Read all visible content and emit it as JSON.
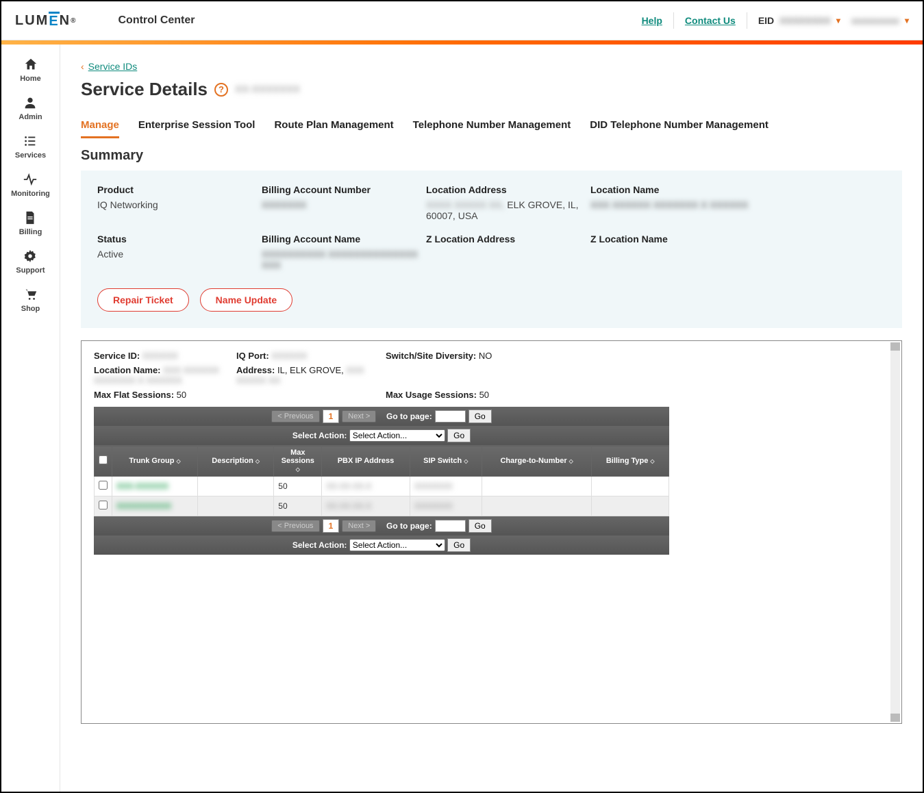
{
  "header": {
    "logo_text": "LUMEN",
    "app_title": "Control Center",
    "help": "Help",
    "contact": "Contact Us",
    "eid_label": "EID",
    "eid_value": "XXXXXXXX",
    "user_value": "xxxxxxxxx"
  },
  "sidebar": [
    {
      "name": "home",
      "label": "Home"
    },
    {
      "name": "admin",
      "label": "Admin"
    },
    {
      "name": "services",
      "label": "Services"
    },
    {
      "name": "monitoring",
      "label": "Monitoring"
    },
    {
      "name": "billing",
      "label": "Billing"
    },
    {
      "name": "support",
      "label": "Support"
    },
    {
      "name": "shop",
      "label": "Shop"
    }
  ],
  "breadcrumb": {
    "back_label": "Service IDs"
  },
  "page": {
    "title": "Service Details",
    "id_value": "XX-XXXXXXX"
  },
  "tabs": [
    {
      "label": "Manage",
      "active": true
    },
    {
      "label": "Enterprise Session Tool"
    },
    {
      "label": "Route Plan Management"
    },
    {
      "label": "Telephone Number Management"
    },
    {
      "label": "DID Telephone Number Management"
    }
  ],
  "summary": {
    "heading": "Summary",
    "product": {
      "label": "Product",
      "value": "IQ Networking"
    },
    "ban": {
      "label": "Billing Account Number",
      "value": "XXXXXXX"
    },
    "loc_addr": {
      "label": "Location Address",
      "value_prefix": "XXXX XXXXX XX,",
      "value_suffix": " ELK GROVE, IL, 60007, USA"
    },
    "loc_name": {
      "label": "Location Name",
      "value": "XXX XXXXXX XXXXXXX X XXXXXX"
    },
    "status": {
      "label": "Status",
      "value": "Active"
    },
    "ba_name": {
      "label": "Billing Account Name",
      "value": "XXXXXXXXXX XXXXXXXXXXXXXX XXX"
    },
    "z_loc_addr": {
      "label": "Z Location Address",
      "value": ""
    },
    "z_loc_name": {
      "label": "Z Location Name",
      "value": ""
    },
    "buttons": {
      "repair": "Repair Ticket",
      "name_update": "Name Update"
    }
  },
  "inner": {
    "service_id": {
      "label": "Service ID:",
      "value": "XXXXXX"
    },
    "iq_port": {
      "label": "IQ Port:",
      "value": "XXXXXX"
    },
    "switch_div": {
      "label": "Switch/Site Diversity:",
      "value": "NO"
    },
    "loc_name": {
      "label": "Location Name:",
      "value": "XXX XXXXXX XXXXXXX X XXXXXX"
    },
    "address": {
      "label": "Address:",
      "value_prefix": "IL, ELK GROVE, ",
      "value_suffix": "XXX XXXXX XX"
    },
    "max_flat": {
      "label": "Max Flat Sessions:",
      "value": "50"
    },
    "max_usage": {
      "label": "Max Usage Sessions:",
      "value": "50"
    }
  },
  "pager": {
    "prev": "< Previous",
    "next": "Next >",
    "page_num": "1",
    "goto_label": "Go to page:",
    "go": "Go",
    "select_action_label": "Select Action:",
    "select_action_value": "Select Action..."
  },
  "table": {
    "columns": [
      "",
      "Trunk Group",
      "Description",
      "Max Sessions",
      "PBX IP Address",
      "SIP Switch",
      "Charge-to-Number",
      "Billing Type"
    ],
    "rows": [
      {
        "trunk_group": "XXX-XXXXXX",
        "description": "",
        "max_sessions": "50",
        "pbx_ip": "XX.XX.XX.X",
        "sip_switch": "XXXXXXX",
        "charge_to": "",
        "billing_type": ""
      },
      {
        "trunk_group": "XXXXXXXXXX",
        "description": "",
        "max_sessions": "50",
        "pbx_ip": "XX.XX.XX.X",
        "sip_switch": "XXXXXXX",
        "charge_to": "",
        "billing_type": ""
      }
    ]
  }
}
